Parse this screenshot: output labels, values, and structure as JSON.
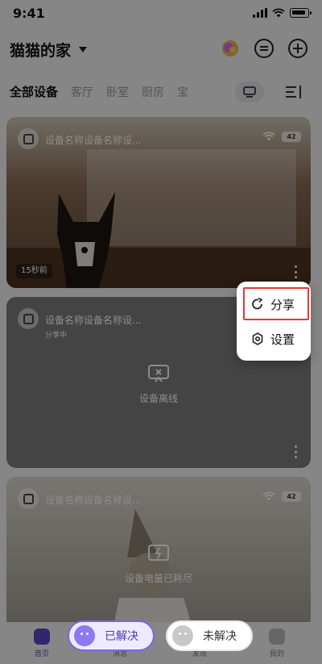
{
  "status_bar": {
    "time": "9:41"
  },
  "header": {
    "home_name": "猫猫的家",
    "message_icon": "message-icon",
    "add_icon": "plus-icon"
  },
  "tabs": [
    {
      "label": "全部设备",
      "active": true
    },
    {
      "label": "客厅",
      "active": false
    },
    {
      "label": "卧室",
      "active": false
    },
    {
      "label": "厨房",
      "active": false
    },
    {
      "label": "宝",
      "active": false
    }
  ],
  "devices": [
    {
      "name": "设备名称设备名称设...",
      "subtitle": "",
      "battery": "42",
      "time_ago": "15秒前",
      "status": ""
    },
    {
      "name": "设备名称设备名称设...",
      "subtitle": "分享中",
      "battery": "",
      "time_ago": "",
      "status": "设备离线"
    },
    {
      "name": "设备名称设备名称设...",
      "subtitle": "",
      "battery": "42",
      "time_ago": "",
      "status": "设备电量已耗尽"
    }
  ],
  "popup_menu": {
    "share_label": "分享",
    "settings_label": "设置"
  },
  "bottom_nav": [
    {
      "label": "首页",
      "active": true
    },
    {
      "label": "消息",
      "active": false
    },
    {
      "label": "发现",
      "active": false
    },
    {
      "label": "我的",
      "active": false
    }
  ],
  "feedback": {
    "resolved_label": "已解决",
    "unresolved_label": "未解决"
  },
  "colors": {
    "accent": "#5a47c8",
    "highlight_border": "#e53935"
  }
}
